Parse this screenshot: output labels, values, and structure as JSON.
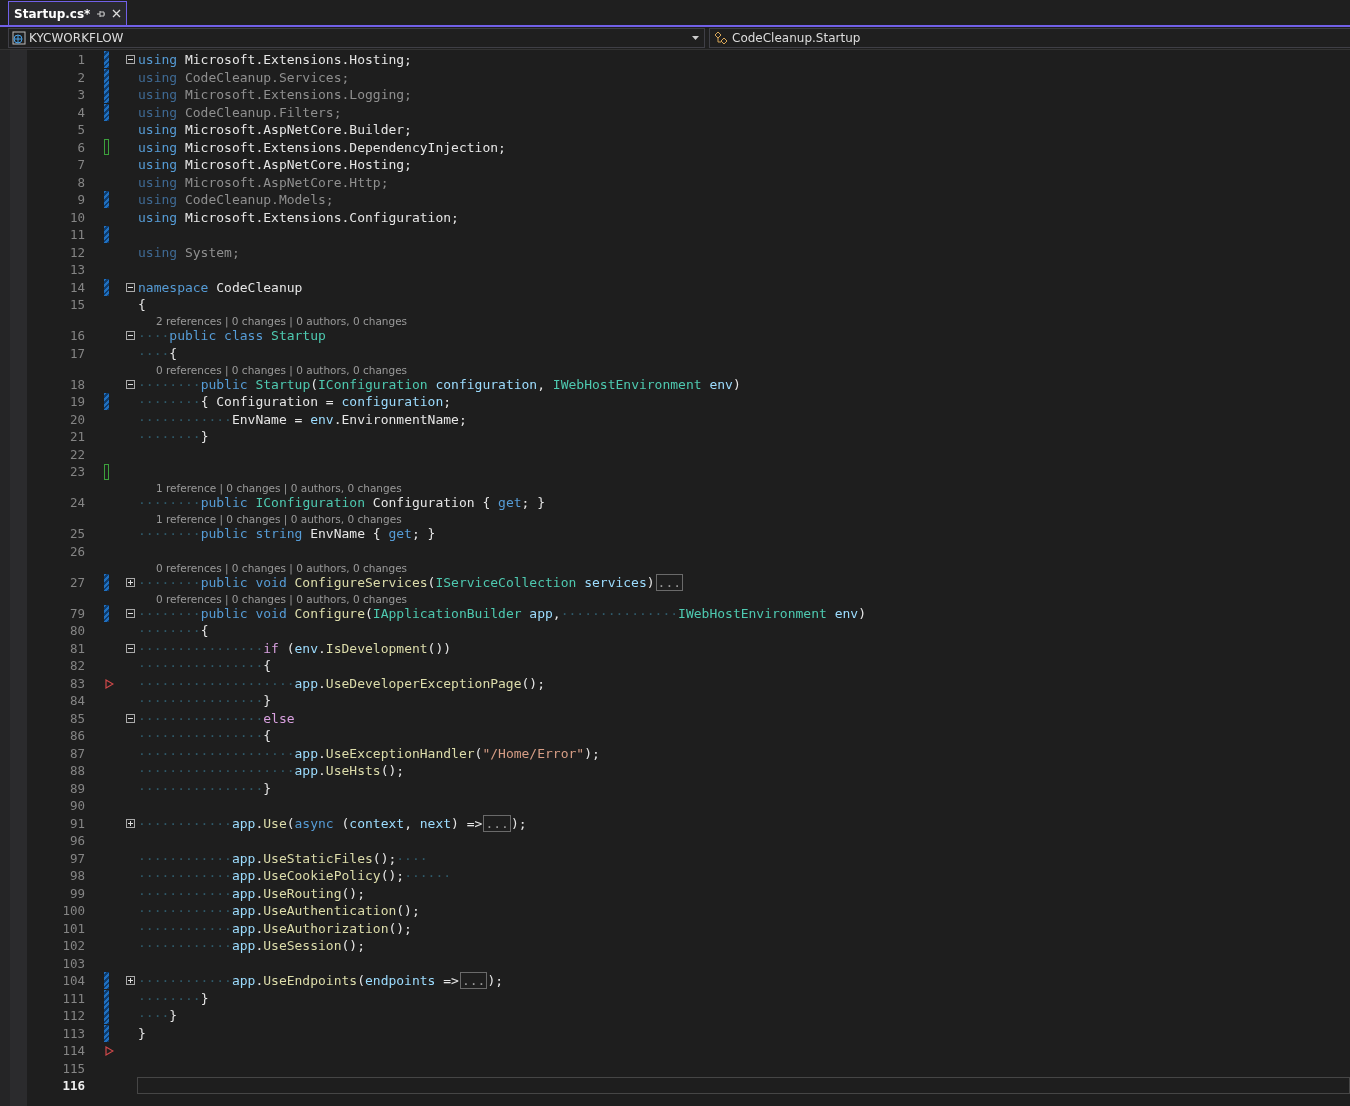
{
  "tab": {
    "title": "Startup.cs*",
    "selected": true
  },
  "nav": {
    "project": "KYCWORKFLOW",
    "member": "CodeCleanup.Startup"
  },
  "editor": {
    "lines": [
      {
        "number": "1",
        "foldable": true,
        "folded": false,
        "changed": true,
        "saved": false,
        "current": false,
        "tokens": [
          {
            "kind": "kw",
            "text": "using"
          },
          {
            "kind": "plain",
            "text": " Microsoft.Extensions.Hosting;"
          }
        ]
      },
      {
        "number": "2",
        "changed": true,
        "saved": false,
        "current": false,
        "tokens": [
          {
            "kind": "kwdim",
            "text": "using"
          },
          {
            "kind": "dim",
            "text": " CodeCleanup.Services;"
          }
        ]
      },
      {
        "number": "3",
        "changed": true,
        "saved": false,
        "current": false,
        "tokens": [
          {
            "kind": "kwdim",
            "text": "using"
          },
          {
            "kind": "dim",
            "text": " Microsoft.Extensions.Logging;"
          }
        ]
      },
      {
        "number": "4",
        "changed": true,
        "saved": false,
        "current": false,
        "tokens": [
          {
            "kind": "kwdim",
            "text": "using"
          },
          {
            "kind": "dim",
            "text": " CodeCleanup.Filters;"
          }
        ]
      },
      {
        "number": "5",
        "current": false,
        "tokens": [
          {
            "kind": "kw",
            "text": "using"
          },
          {
            "kind": "plain",
            "text": " Microsoft.AspNetCore.Builder;"
          }
        ]
      },
      {
        "number": "6",
        "changed": true,
        "saved": true,
        "current": false,
        "tokens": [
          {
            "kind": "kw",
            "text": "using"
          },
          {
            "kind": "plain",
            "text": " Microsoft.Extensions.DependencyInjection;"
          }
        ]
      },
      {
        "number": "7",
        "current": false,
        "tokens": [
          {
            "kind": "kw",
            "text": "using"
          },
          {
            "kind": "plain",
            "text": " Microsoft.AspNetCore.Hosting;"
          }
        ]
      },
      {
        "number": "8",
        "current": false,
        "tokens": [
          {
            "kind": "kwdim",
            "text": "using"
          },
          {
            "kind": "dim",
            "text": " Microsoft.AspNetCore.Http;"
          }
        ]
      },
      {
        "number": "9",
        "changed": true,
        "saved": false,
        "current": false,
        "tokens": [
          {
            "kind": "kwdim",
            "text": "using"
          },
          {
            "kind": "dim",
            "text": " CodeCleanup.Models;"
          }
        ]
      },
      {
        "number": "10",
        "current": false,
        "tokens": [
          {
            "kind": "kw",
            "text": "using"
          },
          {
            "kind": "plain",
            "text": " Microsoft.Extensions.Configuration;"
          }
        ]
      },
      {
        "number": "11",
        "changed": true,
        "saved": false,
        "current": false
      },
      {
        "number": "12",
        "current": false,
        "tokens": [
          {
            "kind": "kwdim",
            "text": "using"
          },
          {
            "kind": "dim",
            "text": " System;"
          }
        ]
      },
      {
        "number": "13",
        "current": false
      },
      {
        "number": "14",
        "foldable": true,
        "folded": false,
        "changed": true,
        "saved": false,
        "current": false,
        "tokens": [
          {
            "kind": "kw",
            "text": "namespace"
          },
          {
            "kind": "plain",
            "text": " CodeCleanup"
          }
        ]
      },
      {
        "number": "15",
        "current": false,
        "tokens": [
          {
            "kind": "plain",
            "text": "{"
          }
        ]
      },
      {
        "number": "16",
        "foldable": true,
        "folded": false,
        "current": false,
        "lens": "2 references | 0 changes | 0 authors, 0 changes",
        "tokens": [
          {
            "kind": "ws",
            "text": "····"
          },
          {
            "kind": "kw",
            "text": "public class"
          },
          {
            "kind": "type",
            "text": " Startup"
          }
        ]
      },
      {
        "number": "17",
        "current": false,
        "tokens": [
          {
            "kind": "ws",
            "text": "····"
          },
          {
            "kind": "plain",
            "text": "{"
          }
        ]
      },
      {
        "number": "18",
        "foldable": true,
        "folded": false,
        "current": false,
        "lens": "0 references | 0 changes | 0 authors, 0 changes",
        "tokens": [
          {
            "kind": "ws",
            "text": "········"
          },
          {
            "kind": "kw",
            "text": "public"
          },
          {
            "kind": "type",
            "text": " Startup"
          },
          {
            "kind": "plain",
            "text": "("
          },
          {
            "kind": "type",
            "text": "IConfiguration"
          },
          {
            "kind": "param",
            "text": " configuration"
          },
          {
            "kind": "plain",
            "text": ", "
          },
          {
            "kind": "type",
            "text": "IWebHostEnvironment"
          },
          {
            "kind": "param",
            "text": " env"
          },
          {
            "kind": "plain",
            "text": ")"
          }
        ]
      },
      {
        "number": "19",
        "changed": true,
        "saved": false,
        "current": false,
        "tokens": [
          {
            "kind": "ws",
            "text": "········"
          },
          {
            "kind": "plain",
            "text": "{ Configuration = "
          },
          {
            "kind": "param",
            "text": "configuration"
          },
          {
            "kind": "plain",
            "text": ";"
          }
        ]
      },
      {
        "number": "20",
        "current": false,
        "tokens": [
          {
            "kind": "ws",
            "text": "············"
          },
          {
            "kind": "plain",
            "text": "EnvName = "
          },
          {
            "kind": "param",
            "text": "env"
          },
          {
            "kind": "plain",
            "text": ".EnvironmentName;"
          }
        ]
      },
      {
        "number": "21",
        "current": false,
        "tokens": [
          {
            "kind": "ws",
            "text": "········"
          },
          {
            "kind": "plain",
            "text": "}"
          }
        ]
      },
      {
        "number": "22",
        "current": false
      },
      {
        "number": "23",
        "changed": true,
        "saved": true,
        "current": false
      },
      {
        "number": "24",
        "current": false,
        "lens": "1 reference | 0 changes | 0 authors, 0 changes",
        "tokens": [
          {
            "kind": "ws",
            "text": "········"
          },
          {
            "kind": "kw",
            "text": "public"
          },
          {
            "kind": "type",
            "text": " IConfiguration"
          },
          {
            "kind": "plain",
            "text": " Configuration { "
          },
          {
            "kind": "kw",
            "text": "get"
          },
          {
            "kind": "plain",
            "text": "; }"
          }
        ]
      },
      {
        "number": "25",
        "current": false,
        "lens": "1 reference | 0 changes | 0 authors, 0 changes",
        "tokens": [
          {
            "kind": "ws",
            "text": "········"
          },
          {
            "kind": "kw",
            "text": "public string"
          },
          {
            "kind": "plain",
            "text": " EnvName { "
          },
          {
            "kind": "kw",
            "text": "get"
          },
          {
            "kind": "plain",
            "text": "; }"
          }
        ]
      },
      {
        "number": "26",
        "current": false
      },
      {
        "number": "27",
        "foldable": true,
        "folded": true,
        "changed": true,
        "saved": false,
        "current": false,
        "lens": "0 references | 0 changes | 0 authors, 0 changes",
        "tokens": [
          {
            "kind": "ws",
            "text": "········"
          },
          {
            "kind": "kw",
            "text": "public void"
          },
          {
            "kind": "method",
            "text": " ConfigureServices"
          },
          {
            "kind": "plain",
            "text": "("
          },
          {
            "kind": "type",
            "text": "IServiceCollection"
          },
          {
            "kind": "param",
            "text": " services"
          },
          {
            "kind": "plain",
            "text": ")"
          },
          {
            "kind": "collapsed",
            "text": "..."
          }
        ]
      },
      {
        "number": "79",
        "foldable": true,
        "folded": false,
        "changed": true,
        "saved": false,
        "current": false,
        "lens": "0 references | 0 changes | 0 authors, 0 changes",
        "tokens": [
          {
            "kind": "ws",
            "text": "········"
          },
          {
            "kind": "kw",
            "text": "public void"
          },
          {
            "kind": "method",
            "text": " Configure"
          },
          {
            "kind": "plain",
            "text": "("
          },
          {
            "kind": "type",
            "text": "IApplicationBuilder"
          },
          {
            "kind": "param",
            "text": " app"
          },
          {
            "kind": "plain",
            "text": ","
          },
          {
            "kind": "ws",
            "text": "···············"
          },
          {
            "kind": "type",
            "text": "IWebHostEnvironment"
          },
          {
            "kind": "param",
            "text": " env"
          },
          {
            "kind": "plain",
            "text": ")"
          }
        ]
      },
      {
        "number": "80",
        "current": false,
        "tokens": [
          {
            "kind": "ws",
            "text": "········"
          },
          {
            "kind": "plain",
            "text": "{"
          }
        ]
      },
      {
        "number": "81",
        "foldable": true,
        "folded": false,
        "current": false,
        "tokens": [
          {
            "kind": "ws",
            "text": "················"
          },
          {
            "kind": "ctrl",
            "text": "if"
          },
          {
            "kind": "plain",
            "text": " ("
          },
          {
            "kind": "param",
            "text": "env"
          },
          {
            "kind": "plain",
            "text": "."
          },
          {
            "kind": "method",
            "text": "IsDevelopment"
          },
          {
            "kind": "plain",
            "text": "())"
          }
        ]
      },
      {
        "number": "82",
        "current": false,
        "tokens": [
          {
            "kind": "ws",
            "text": "················"
          },
          {
            "kind": "plain",
            "text": "{"
          }
        ]
      },
      {
        "number": "83",
        "arrow": true,
        "current": false,
        "tokens": [
          {
            "kind": "ws",
            "text": "····················"
          },
          {
            "kind": "param",
            "text": "app"
          },
          {
            "kind": "plain",
            "text": "."
          },
          {
            "kind": "method",
            "text": "UseDeveloperExceptionPage"
          },
          {
            "kind": "plain",
            "text": "();"
          }
        ]
      },
      {
        "number": "84",
        "current": false,
        "tokens": [
          {
            "kind": "ws",
            "text": "················"
          },
          {
            "kind": "plain",
            "text": "}"
          }
        ]
      },
      {
        "number": "85",
        "foldable": true,
        "folded": false,
        "current": false,
        "tokens": [
          {
            "kind": "ws",
            "text": "················"
          },
          {
            "kind": "ctrl",
            "text": "else"
          }
        ]
      },
      {
        "number": "86",
        "current": false,
        "tokens": [
          {
            "kind": "ws",
            "text": "················"
          },
          {
            "kind": "plain",
            "text": "{"
          }
        ]
      },
      {
        "number": "87",
        "current": false,
        "tokens": [
          {
            "kind": "ws",
            "text": "····················"
          },
          {
            "kind": "param",
            "text": "app"
          },
          {
            "kind": "plain",
            "text": "."
          },
          {
            "kind": "method",
            "text": "UseExceptionHandler"
          },
          {
            "kind": "plain",
            "text": "("
          },
          {
            "kind": "string",
            "text": "\"/Home/Error\""
          },
          {
            "kind": "plain",
            "text": ");"
          }
        ]
      },
      {
        "number": "88",
        "current": false,
        "tokens": [
          {
            "kind": "ws",
            "text": "····················"
          },
          {
            "kind": "param",
            "text": "app"
          },
          {
            "kind": "plain",
            "text": "."
          },
          {
            "kind": "method",
            "text": "UseHsts"
          },
          {
            "kind": "plain",
            "text": "();"
          }
        ]
      },
      {
        "number": "89",
        "current": false,
        "tokens": [
          {
            "kind": "ws",
            "text": "················"
          },
          {
            "kind": "plain",
            "text": "}"
          }
        ]
      },
      {
        "number": "90",
        "current": false
      },
      {
        "number": "91",
        "foldable": true,
        "folded": true,
        "current": false,
        "tokens": [
          {
            "kind": "ws",
            "text": "············"
          },
          {
            "kind": "param",
            "text": "app"
          },
          {
            "kind": "plain",
            "text": "."
          },
          {
            "kind": "method",
            "text": "Use"
          },
          {
            "kind": "plain",
            "text": "("
          },
          {
            "kind": "kw",
            "text": "async"
          },
          {
            "kind": "plain",
            "text": " ("
          },
          {
            "kind": "param",
            "text": "context"
          },
          {
            "kind": "plain",
            "text": ", "
          },
          {
            "kind": "param",
            "text": "next"
          },
          {
            "kind": "plain",
            "text": ") =>"
          },
          {
            "kind": "collapsed",
            "text": "..."
          },
          {
            "kind": "plain",
            "text": ");"
          }
        ]
      },
      {
        "number": "96",
        "current": false
      },
      {
        "number": "97",
        "current": false,
        "tokens": [
          {
            "kind": "ws",
            "text": "············"
          },
          {
            "kind": "param",
            "text": "app"
          },
          {
            "kind": "plain",
            "text": "."
          },
          {
            "kind": "method",
            "text": "UseStaticFiles"
          },
          {
            "kind": "plain",
            "text": "();"
          },
          {
            "kind": "ws",
            "text": "····"
          }
        ]
      },
      {
        "number": "98",
        "current": false,
        "tokens": [
          {
            "kind": "ws",
            "text": "············"
          },
          {
            "kind": "param",
            "text": "app"
          },
          {
            "kind": "plain",
            "text": "."
          },
          {
            "kind": "method",
            "text": "UseCookiePolicy"
          },
          {
            "kind": "plain",
            "text": "();"
          },
          {
            "kind": "ws",
            "text": "······"
          }
        ]
      },
      {
        "number": "99",
        "current": false,
        "tokens": [
          {
            "kind": "ws",
            "text": "············"
          },
          {
            "kind": "param",
            "text": "app"
          },
          {
            "kind": "plain",
            "text": "."
          },
          {
            "kind": "method",
            "text": "UseRouting"
          },
          {
            "kind": "plain",
            "text": "();"
          }
        ]
      },
      {
        "number": "100",
        "current": false,
        "tokens": [
          {
            "kind": "ws",
            "text": "············"
          },
          {
            "kind": "param",
            "text": "app"
          },
          {
            "kind": "plain",
            "text": "."
          },
          {
            "kind": "method",
            "text": "UseAuthentication"
          },
          {
            "kind": "plain",
            "text": "();"
          }
        ]
      },
      {
        "number": "101",
        "current": false,
        "tokens": [
          {
            "kind": "ws",
            "text": "············"
          },
          {
            "kind": "param",
            "text": "app"
          },
          {
            "kind": "plain",
            "text": "."
          },
          {
            "kind": "method",
            "text": "UseAuthorization"
          },
          {
            "kind": "plain",
            "text": "();"
          }
        ]
      },
      {
        "number": "102",
        "current": false,
        "tokens": [
          {
            "kind": "ws",
            "text": "············"
          },
          {
            "kind": "param",
            "text": "app"
          },
          {
            "kind": "plain",
            "text": "."
          },
          {
            "kind": "method",
            "text": "UseSession"
          },
          {
            "kind": "plain",
            "text": "();"
          }
        ]
      },
      {
        "number": "103",
        "current": false
      },
      {
        "number": "104",
        "foldable": true,
        "folded": true,
        "changed": true,
        "saved": false,
        "current": false,
        "tokens": [
          {
            "kind": "ws",
            "text": "············"
          },
          {
            "kind": "param",
            "text": "app"
          },
          {
            "kind": "plain",
            "text": "."
          },
          {
            "kind": "method",
            "text": "UseEndpoints"
          },
          {
            "kind": "plain",
            "text": "("
          },
          {
            "kind": "param",
            "text": "endpoints"
          },
          {
            "kind": "plain",
            "text": " =>"
          },
          {
            "kind": "collapsed",
            "text": "..."
          },
          {
            "kind": "plain",
            "text": ");"
          }
        ]
      },
      {
        "number": "111",
        "changed": true,
        "saved": false,
        "current": false,
        "tokens": [
          {
            "kind": "ws",
            "text": "········"
          },
          {
            "kind": "plain",
            "text": "}"
          }
        ]
      },
      {
        "number": "112",
        "changed": true,
        "saved": false,
        "current": false,
        "tokens": [
          {
            "kind": "ws",
            "text": "····"
          },
          {
            "kind": "plain",
            "text": "}"
          }
        ]
      },
      {
        "number": "113",
        "changed": true,
        "saved": false,
        "current": false,
        "tokens": [
          {
            "kind": "plain",
            "text": "}"
          }
        ]
      },
      {
        "number": "114",
        "arrow": true,
        "current": false
      },
      {
        "number": "115",
        "current": false
      },
      {
        "number": "116",
        "current": true
      }
    ]
  }
}
